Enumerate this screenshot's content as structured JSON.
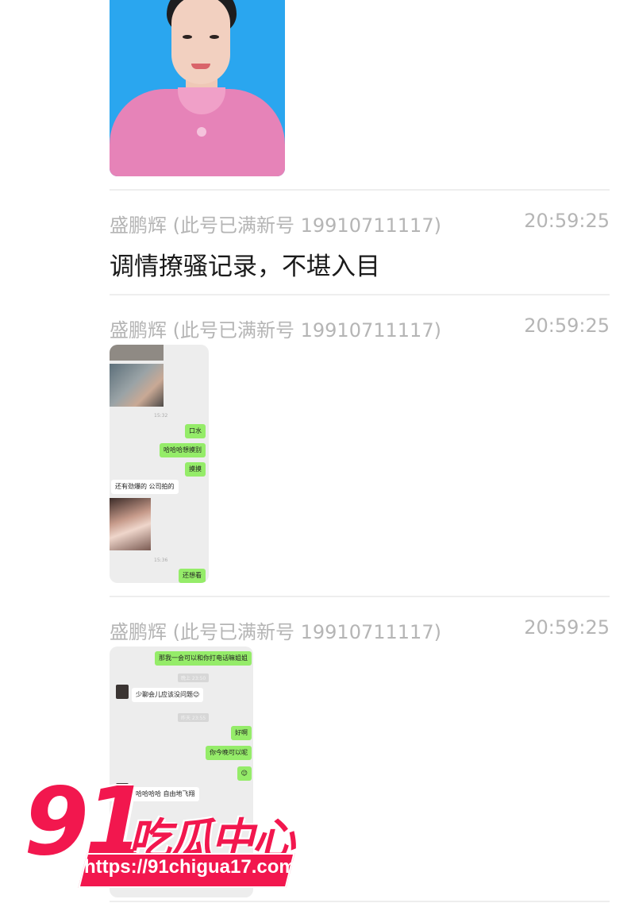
{
  "feed": {
    "items": [
      {
        "sender": "盛鹏辉 (此号已满新号 19910711117)",
        "time": "20:59:25",
        "text": "调情撩骚记录，不堪入目"
      },
      {
        "sender": "盛鹏辉 (此号已满新号 19910711117)",
        "time": "20:59:25",
        "chat": {
          "stamps": [
            "15:32",
            "15:36"
          ],
          "messages": [
            {
              "side": "right",
              "text": "口水"
            },
            {
              "side": "right",
              "text": "哈哈哈想摸别"
            },
            {
              "side": "right",
              "text": "摸摸"
            },
            {
              "side": "left",
              "text": "还有劲爆的 公司拍的"
            },
            {
              "side": "right",
              "text": "还想看"
            }
          ]
        }
      },
      {
        "sender": "盛鹏辉 (此号已满新号 19910711117)",
        "time": "20:59:25",
        "chat": {
          "stamps": [
            "晚上 23:50",
            "昨天 23:55"
          ],
          "messages": [
            {
              "side": "right",
              "text": "那我一会可以和你打电话嘛姐姐"
            },
            {
              "side": "left",
              "text": "少聊会儿应该没问题😉"
            },
            {
              "side": "right",
              "text": "好啊"
            },
            {
              "side": "right",
              "text": "你今晚可以呢"
            },
            {
              "side": "right",
              "text": "😉"
            },
            {
              "side": "left",
              "text": "哈哈哈哈 自由地飞翔"
            }
          ]
        }
      }
    ]
  },
  "watermark": {
    "number": "91",
    "brand": "吃瓜中心",
    "url": "https://91chigua17.com"
  },
  "colors": {
    "meta_text": "#b5b5b5",
    "chat_bg": "#ededed",
    "bubble_green": "#95ec69",
    "watermark": "#f2174e"
  }
}
